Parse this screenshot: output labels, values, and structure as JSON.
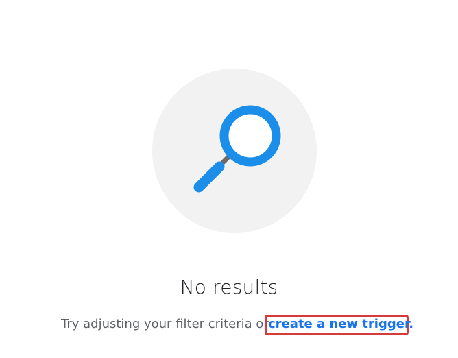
{
  "empty_state": {
    "icon": "magnifying-glass-icon",
    "title": "No results",
    "message": "Try adjusting your filter criteria or",
    "link_label": "create a new trigger.",
    "colors": {
      "icon_blue": "#1a8ee8",
      "icon_handle_dark": "#5f6368",
      "circle_bg": "#f2f2f2",
      "link": "#1a73e8",
      "highlight_border": "#d63b3b"
    }
  }
}
